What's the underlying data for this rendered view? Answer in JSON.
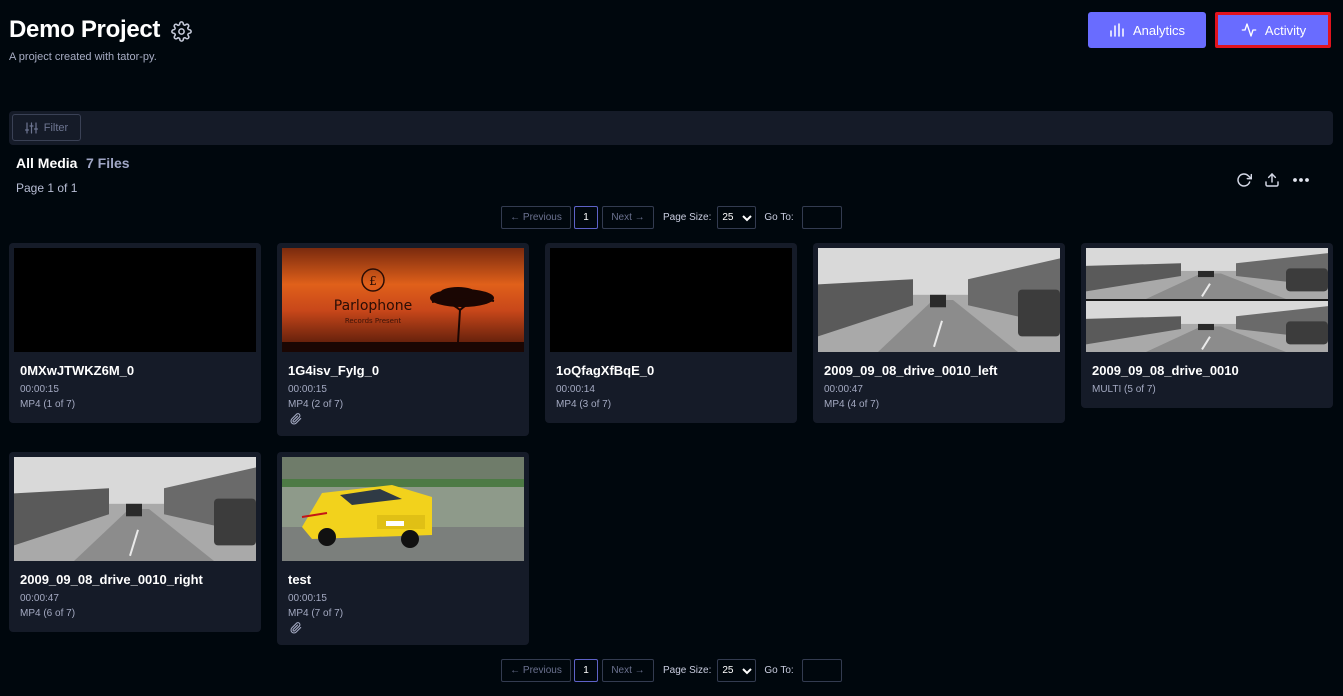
{
  "header": {
    "title": "Demo Project",
    "description": "A project created with tator-py.",
    "analytics_label": "Analytics",
    "activity_label": "Activity"
  },
  "filter": {
    "label": "Filter"
  },
  "section": {
    "title": "All Media",
    "count": "7 Files",
    "page_info": "Page 1 of 1"
  },
  "pagination": {
    "previous": "← Previous",
    "current": "1",
    "next": "Next →",
    "page_size_label": "Page Size:",
    "page_size": "25",
    "goto_label": "Go To:"
  },
  "media": [
    {
      "name": "0MXwJTWKZ6M_0",
      "duration": "00:00:15",
      "type": "MP4  (1 of 7)",
      "thumb": "black",
      "attachment": false
    },
    {
      "name": "1G4isv_FyIg_0",
      "duration": "00:00:15",
      "type": "MP4  (2 of 7)",
      "thumb": "sunset",
      "thumb_text": "Parlophone",
      "thumb_subtext": "Records Present",
      "attachment": true
    },
    {
      "name": "1oQfagXfBqE_0",
      "duration": "00:00:14",
      "type": "MP4  (3 of 7)",
      "thumb": "black",
      "attachment": false
    },
    {
      "name": "2009_09_08_drive_0010_left",
      "duration": "00:00:47",
      "type": "MP4  (4 of 7)",
      "thumb": "street",
      "attachment": false
    },
    {
      "name": "2009_09_08_drive_0010",
      "duration": "",
      "type": "MULTI  (5 of 7)",
      "thumb": "street-split",
      "attachment": false
    },
    {
      "name": "2009_09_08_drive_0010_right",
      "duration": "00:00:47",
      "type": "MP4  (6 of 7)",
      "thumb": "street",
      "attachment": false
    },
    {
      "name": "test",
      "duration": "00:00:15",
      "type": "MP4  (7 of 7)",
      "thumb": "yellow-car",
      "attachment": true
    }
  ],
  "colors": {
    "background": "#00070d",
    "panel": "#151b28",
    "accent": "#696cff",
    "highlight_border": "#e1131e"
  }
}
